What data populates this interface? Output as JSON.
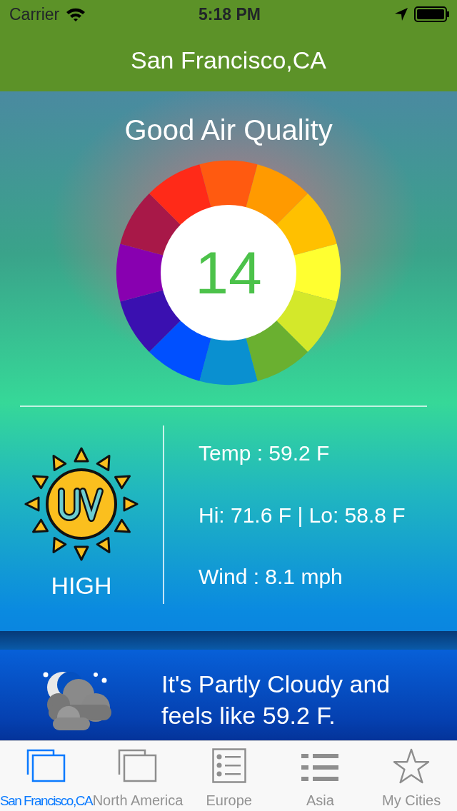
{
  "status_bar": {
    "carrier": "Carrier",
    "time": "5:18 PM"
  },
  "nav": {
    "title": "San Francisco,CA"
  },
  "air_quality": {
    "label": "Good Air Quality",
    "value": "14"
  },
  "uv": {
    "label": "HIGH"
  },
  "conditions": [
    {
      "text": "Temp : 59.2 F"
    },
    {
      "text": "Hi: 71.6 F | Lo: 58.8 F"
    },
    {
      "text": "Wind : 8.1 mph"
    }
  ],
  "summary": {
    "text": "It's Partly Cloudy and feels like 59.2 F."
  },
  "tabs": [
    {
      "label": "San Francisco,CA",
      "kind": "windows",
      "selected": true
    },
    {
      "label": "North America",
      "kind": "windows",
      "selected": false
    },
    {
      "label": "Europe",
      "kind": "starlist",
      "selected": false
    },
    {
      "label": "Asia",
      "kind": "list",
      "selected": false
    },
    {
      "label": "My Cities",
      "kind": "star",
      "selected": false
    }
  ]
}
